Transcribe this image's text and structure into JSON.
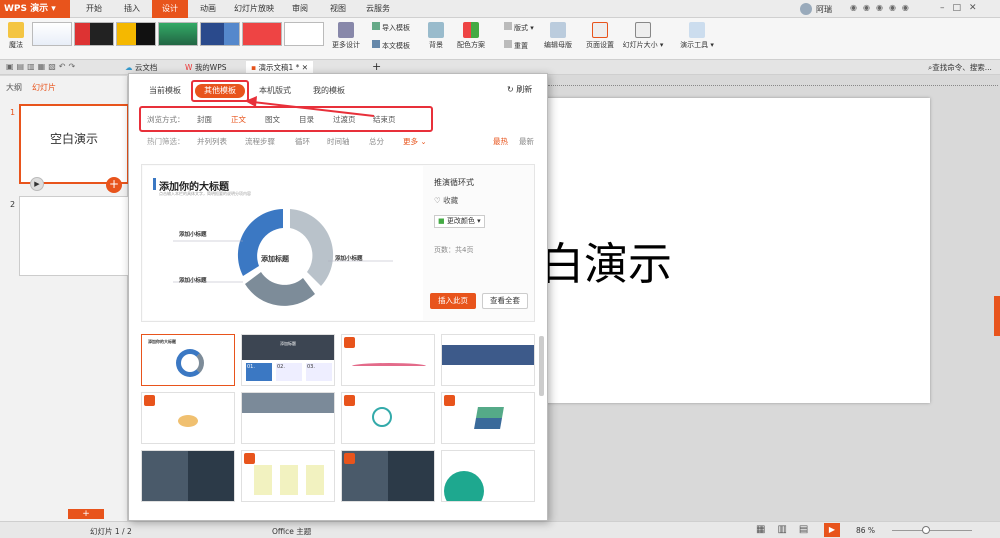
{
  "app": {
    "name": "WPS 演示"
  },
  "menu": {
    "tabs": [
      "开始",
      "插入",
      "设计",
      "动画",
      "幻灯片放映",
      "审阅",
      "视图",
      "云服务"
    ],
    "active_index": 2
  },
  "user": {
    "name": "阿瑞"
  },
  "ribbon": {
    "magic_label": "魔法",
    "more_design": "更多设计",
    "import_template": "导入模板",
    "text_template": "本文模板",
    "background": "背景",
    "color_scheme": "配色方案",
    "layout": "版式",
    "reset": "重置",
    "edit_master": "编辑母版",
    "page_setup": "页面设置",
    "slide_size": "幻灯片大小",
    "presentation_tools": "演示工具"
  },
  "docbar": {
    "tabs": [
      "云文档",
      "我的WPS",
      "演示文稿1 *"
    ],
    "search_placeholder": "查找命令、搜索..."
  },
  "left": {
    "outline": "大纲",
    "slides": "幻灯片",
    "slide1_title": "空白演示",
    "slide1_num": "1",
    "slide2_num": "2"
  },
  "slide": {
    "title_fragment": "白演示"
  },
  "status": {
    "slide_info": "幻灯片 1 / 2",
    "theme": "Office 主题",
    "zoom": "86 %"
  },
  "popup": {
    "tabs": [
      "当前模板",
      "其他模板",
      "本机版式",
      "我的模板"
    ],
    "refresh": "刷新",
    "browse_label": "浏览方式：",
    "browse_items": [
      "封面",
      "正文",
      "图文",
      "目录",
      "过渡页",
      "结束页"
    ],
    "browse_active": 1,
    "hot_label": "热门筛选：",
    "hot_items": [
      "并列列表",
      "流程步骤",
      "循环",
      "时间轴",
      "总分"
    ],
    "more": "更多",
    "sort_hot": "最热",
    "sort_new": "最新",
    "preview": {
      "heading": "添加你的大标题",
      "subheading": "点击输入本栏的具体文字，简明扼要的说明分项内容",
      "center_title": "添加标题",
      "sub_title": "添加小标题",
      "name": "推演循环式",
      "favorite": "收藏",
      "change_color": "更改颜色",
      "pages": "页数：共4页",
      "insert_btn": "插入此页",
      "view_all_btn": "查看全套"
    },
    "grid_thumb_texts": [
      "添加你的大标题",
      "添加标题",
      "01.",
      "02.",
      "03."
    ]
  },
  "colors": {
    "accent": "#e8541c",
    "highlight": "#e8303a",
    "ring_blue": "#3b78c3",
    "ring_gray": "#7d8c99"
  }
}
